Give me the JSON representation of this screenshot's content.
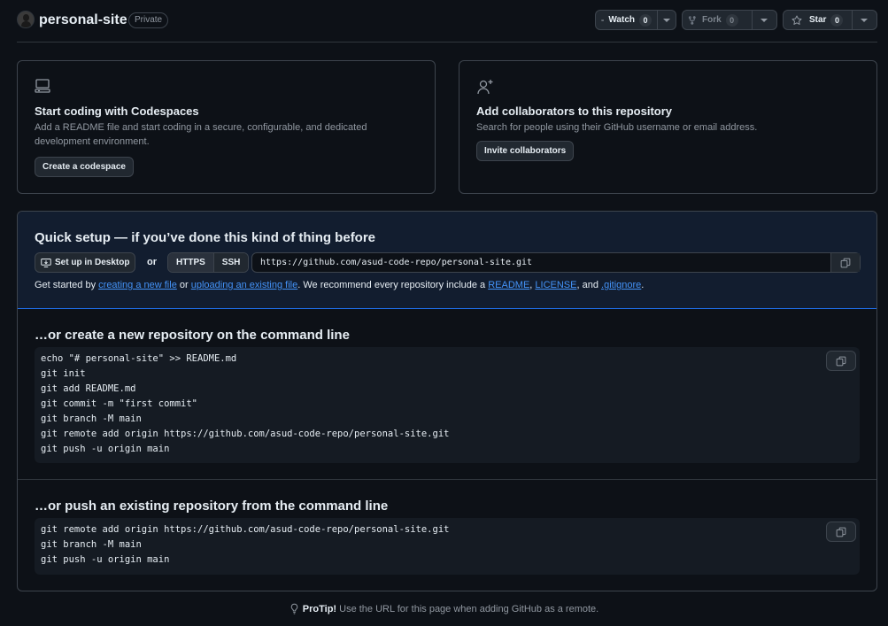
{
  "header": {
    "repo_name": "personal-site",
    "visibility": "Private",
    "watch_label": "Watch",
    "watch_count": "0",
    "fork_label": "Fork",
    "fork_count": "0",
    "star_label": "Star",
    "star_count": "0"
  },
  "codespaces_card": {
    "icon": "codespaces-icon",
    "title": "Start coding with Codespaces",
    "description": "Add a README file and start coding in a secure, configurable, and dedicated development environment.",
    "button_label": "Create a codespace"
  },
  "collaborators_card": {
    "icon": "person-add-icon",
    "title": "Add collaborators to this repository",
    "description": "Search for people using their GitHub username or email address.",
    "button_label": "Invite collaborators"
  },
  "quick_setup": {
    "title": "Quick setup — if you’ve done this kind of thing before",
    "desktop_button": "Set up in Desktop",
    "or_text": "or",
    "protocol_https": "HTTPS",
    "protocol_ssh": "SSH",
    "selected_protocol": "HTTPS",
    "clone_url": "https://github.com/asud-code-repo/personal-site.git",
    "hint": {
      "prefix": "Get started by ",
      "link_new_file": "creating a new file",
      "or": " or ",
      "link_upload": "uploading an existing file",
      "middle": ". We recommend every repository include a ",
      "link_readme": "README",
      "comma1": ", ",
      "link_license": "LICENSE",
      "and": ", and ",
      "link_gitignore": ".gitignore",
      "suffix": "."
    }
  },
  "new_repo_section": {
    "title": "…or create a new repository on the command line",
    "lines": [
      "echo \"# personal-site\" >> README.md",
      "git init",
      "git add README.md",
      "git commit -m \"first commit\"",
      "git branch -M main",
      "git remote add origin https://github.com/asud-code-repo/personal-site.git",
      "git push -u origin main"
    ]
  },
  "push_existing_section": {
    "title": "…or push an existing repository from the command line",
    "lines": [
      "git remote add origin https://github.com/asud-code-repo/personal-site.git",
      "git branch -M main",
      "git push -u origin main"
    ]
  },
  "protip": {
    "label": "ProTip!",
    "text": " Use the URL for this page when adding GitHub as a remote."
  },
  "colors": {
    "background": "#0d1117",
    "link": "#4493f8",
    "quick_setup_bg": "#121d2f",
    "border": "#3d444d"
  }
}
